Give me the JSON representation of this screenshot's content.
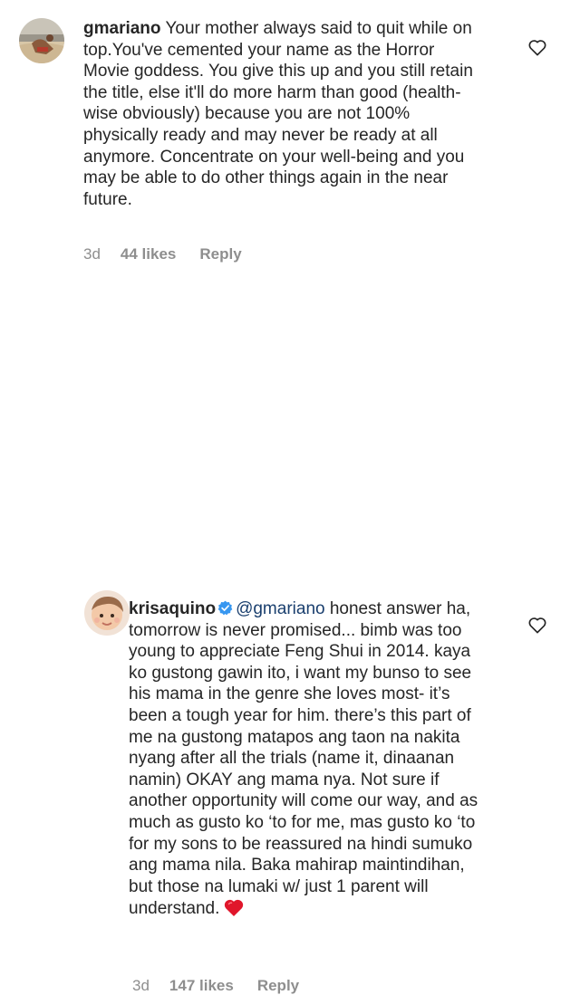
{
  "comments": [
    {
      "username": "gmariano",
      "text": "Your mother always said to quit while on top.You've cemented your name as the Horror Movie goddess. You give this up and you still retain the title, else it'll do more harm than good (health-wise obviously) because you are not 100% physically ready and may never be ready at all anymore. Concentrate on your well-being and you may be able to do other things again in the near future.",
      "time": "3d",
      "likes": "44 likes",
      "reply_label": "Reply"
    },
    {
      "username": "krisaquino",
      "verified": true,
      "mention": "@gmariano",
      "text": "honest answer ha, tomorrow is never promised... bimb was too young to appreciate Feng Shui in 2014. kaya ko gustong gawin ito, i want my bunso to see his mama in the genre she loves most- it’s been a tough year for him. there’s this part of me na gustong matapos ang taon na nakita nyang after all the trials (name it, dinaanan namin) OKAY ang mama nya. Not sure if another opportunity will come our way, and as much as gusto ko ‘to for me, mas gusto ko ‘to for my sons to be reassured na hindi sumuko ang mama nila. Baka mahirap maintindihan, but those na lumaki w/ just 1 parent will understand.",
      "emoji": "red-heart-emoji",
      "time": "3d",
      "likes": "147 likes",
      "reply_label": "Reply"
    }
  ],
  "colors": {
    "text": "#262626",
    "meta": "#8e8e8e",
    "mention": "#1a3f6e",
    "verified_badge": "#3897f0",
    "heart_outline": "#262626",
    "heart_emoji": "#e0162b"
  }
}
